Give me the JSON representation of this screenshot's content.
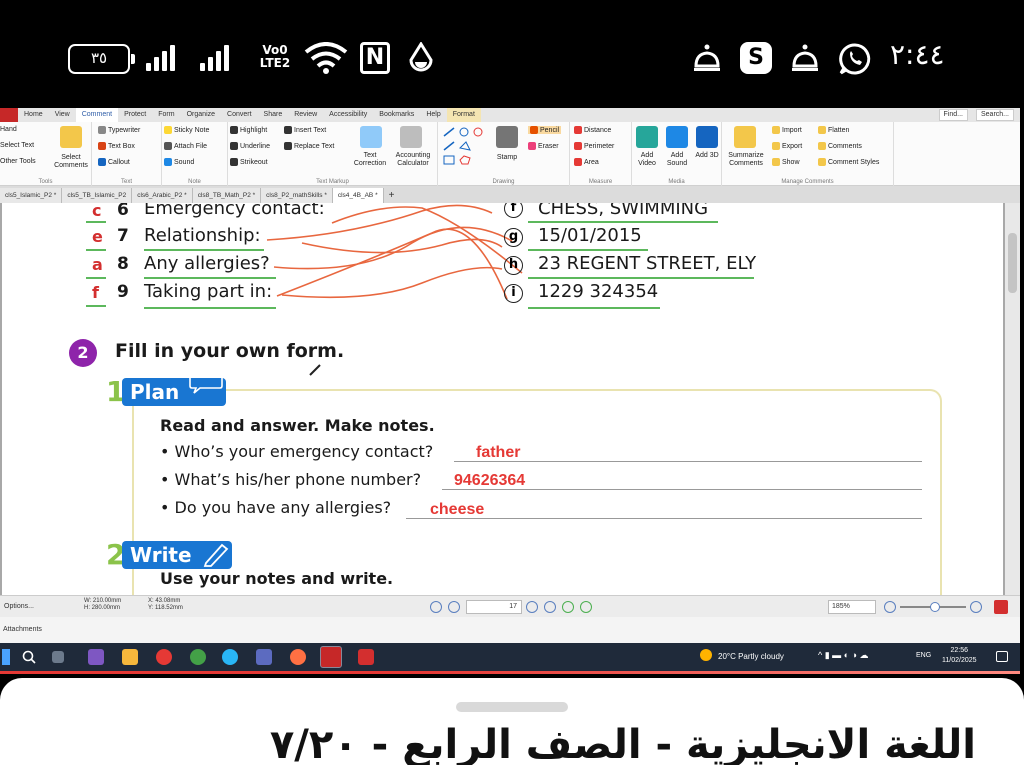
{
  "status_bar": {
    "battery": "٣٥",
    "volte_top": "Vo0",
    "volte_bottom": "LTE2",
    "nfc": "N",
    "time": "٢:٤٤",
    "s_badge": "S"
  },
  "menubar": {
    "tabs": [
      "Home",
      "View",
      "Comment",
      "Protect",
      "Form",
      "Organize",
      "Convert",
      "Share",
      "Review",
      "Accessibility",
      "Bookmarks",
      "Help",
      "Format"
    ],
    "active_tab": "Comment",
    "find": "Find...",
    "search": "Search..."
  },
  "ribbon": {
    "tools": [
      "Hand",
      "Select Text",
      "Other Tools"
    ],
    "select_comments": "Select Comments",
    "text_items": [
      "Typewriter",
      "Text Box",
      "Callout"
    ],
    "note_items": [
      "Sticky Note",
      "Attach File",
      "Sound"
    ],
    "markup_items": [
      "Highlight",
      "Underline",
      "Strikeout"
    ],
    "markup_items2": [
      "Insert Text",
      "Replace Text"
    ],
    "text_correction": "Text Correction",
    "accounting_calculator": "Accounting Calculator",
    "stamp": "Stamp",
    "pencil": "Pencil",
    "eraser": "Eraser",
    "measure_items": [
      "Distance",
      "Perimeter",
      "Area"
    ],
    "media_items": [
      "Add Video",
      "Add Sound",
      "Add 3D"
    ],
    "summarize": "Summarize Comments",
    "manage_items": [
      "Import",
      "Export",
      "Show"
    ],
    "manage_items2": [
      "Flatten",
      "Comments",
      "Comment Styles"
    ],
    "group_names": [
      "Tools",
      "Text",
      "Note",
      "Text Markup",
      "Drawing",
      "Measure",
      "Media",
      "Manage Comments"
    ]
  },
  "doc_tabs": [
    "cls5_Islamic_P2 *",
    "cls5_TB_Islamic_P2",
    "cls6_Arabic_P2 *",
    "cls8_TB_Math_P2 *",
    "cls8_P2_mathSkills *",
    "cls4_4B_AB *"
  ],
  "active_doc_tab": "cls4_4B_AB *",
  "worksheet": {
    "rows": [
      {
        "letter": "c",
        "num": "6",
        "label": "Emergency contact:"
      },
      {
        "letter": "e",
        "num": "7",
        "label": "Relationship:"
      },
      {
        "letter": "a",
        "num": "8",
        "label": "Any allergies?"
      },
      {
        "letter": "f",
        "num": "9",
        "label": "Taking part in:"
      }
    ],
    "answers": [
      {
        "letter": "f",
        "text": "CHESS, SWIMMING"
      },
      {
        "letter": "g",
        "text": "15/01/2015"
      },
      {
        "letter": "h",
        "text": "23 REGENT STREET, ELY"
      },
      {
        "letter": "i",
        "text": "1229 324354"
      }
    ],
    "exercise_num": "2",
    "exercise_title": "Fill in your own form.",
    "plan_num": "1",
    "plan_label": "Plan",
    "plan_instruction": "Read and answer. Make notes.",
    "questions": [
      {
        "q": "• Who’s your emergency contact?",
        "a": "father"
      },
      {
        "q": "• What’s his/her phone number?",
        "a": "94626364"
      },
      {
        "q": "• Do you have any allergies?",
        "a": "cheese"
      }
    ],
    "write_num": "2",
    "write_label": "Write",
    "write_instruction": "Use your notes and write."
  },
  "status_strip": {
    "options": "Options...",
    "width": "W: 210.00mm",
    "height": "H: 280.00mm",
    "x": "X: 43.08mm",
    "y": "Y: 118.52mm",
    "page": "17",
    "zoom": "185%"
  },
  "attachments": "Attachments",
  "taskbar": {
    "weather": "20°C  Partly cloudy",
    "lang": "ENG",
    "time": "22:56",
    "date": "11/02/2025"
  },
  "bottom_sheet": {
    "title": "اللغة الانجليزية - الصف الرابع - ٧/٢٠"
  },
  "colors": {
    "red_answer": "#e53935",
    "plan_blue": "#1976d2",
    "exercise_purple": "#8e24aa",
    "green_line": "#5cb85c"
  }
}
